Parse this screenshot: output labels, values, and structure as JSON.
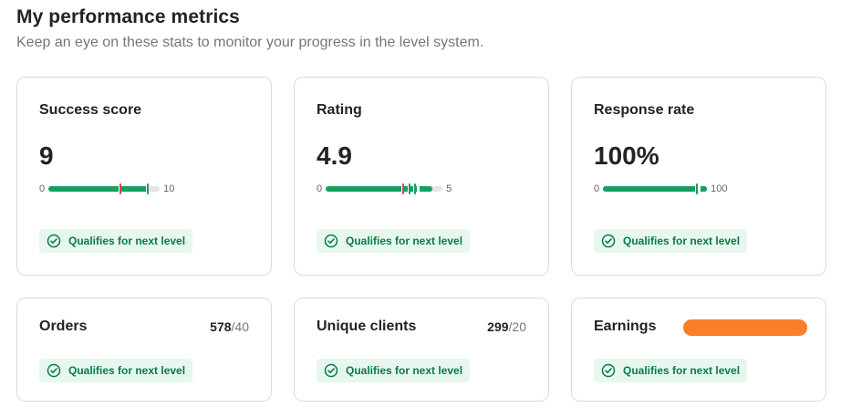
{
  "header": {
    "title": "My performance metrics",
    "subtitle": "Keep an eye on these stats to monitor your progress in the level system."
  },
  "metrics": [
    {
      "label": "Success score",
      "value": "9",
      "min": "0",
      "max": "10",
      "progress": 0.9,
      "badge": "Qualifies for next level"
    },
    {
      "label": "Rating",
      "value": "4.9",
      "min": "0",
      "max": "5",
      "progress": 0.98,
      "badge": "Qualifies for next level"
    },
    {
      "label": "Response rate",
      "value": "100%",
      "min": "0",
      "max": "100",
      "progress": 1.0,
      "badge": "Qualifies for next level"
    }
  ],
  "counters": [
    {
      "label": "Orders",
      "count": "578",
      "target": "/40",
      "badge": "Qualifies for next level"
    },
    {
      "label": "Unique clients",
      "count": "299",
      "target": "/20",
      "badge": "Qualifies for next level"
    },
    {
      "label": "Earnings",
      "redacted": true,
      "badge": "Qualifies for next level"
    }
  ],
  "colors": {
    "accent_green": "#16a060",
    "badge_bg": "#e7f7ee",
    "badge_text": "#0b7a49",
    "marker_red": "#d0484e",
    "redaction": "#fb7f26"
  },
  "icons": {
    "badge_icon": "check-circle-icon"
  }
}
